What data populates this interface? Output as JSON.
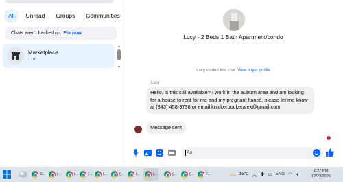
{
  "left_panel": {
    "filters": [
      "All",
      "Unread",
      "Groups",
      "Communities"
    ],
    "active_filter": "All",
    "backup_notice": "Chats aren't backed up.",
    "backup_fix": "Fix now",
    "conversations": [
      {
        "name": "Marketplace",
        "time": "· 1m",
        "icon": "storefront-icon"
      }
    ]
  },
  "chat": {
    "title": "Lucy - 2 Beds 1 Bath Apartment/condo",
    "started_text": "Lucy started this chat.",
    "view_profile": "View buyer profile",
    "sender": "Lucy",
    "messages": [
      "Hello, is this still available? I work in the auburn area and am looking for a house to rent for me and my pregnant fiancé, please let me know at (843) 458-3736 or email knickerbockeralex@gmail.com",
      "Message sent"
    ],
    "composer_placeholder": "Aa",
    "composer_icons": [
      "microphone-icon",
      "photo-icon",
      "sticker-icon",
      "gif-icon"
    ],
    "accent_color": "#0866ff"
  },
  "taskbar": {
    "items": [
      {
        "label": "S...",
        "icon": "chrome-icon"
      },
      {
        "label": "(...",
        "icon": "chrome-icon"
      },
      {
        "label": "(...",
        "icon": "chrome-icon"
      },
      {
        "label": "(...",
        "icon": "chrome-icon"
      },
      {
        "label": "(...",
        "icon": "chrome-icon"
      },
      {
        "label": "(...",
        "icon": "chrome-icon"
      },
      {
        "label": "(...",
        "icon": "chrome-icon"
      },
      {
        "label": "(...",
        "icon": "chrome-icon"
      },
      {
        "label": "(...",
        "icon": "chrome-icon"
      },
      {
        "label": "(...",
        "icon": "chrome-icon"
      },
      {
        "label": "F...",
        "icon": "chrome-icon"
      }
    ],
    "weather": "15°C",
    "language": "ENG",
    "time": "8:27 PM",
    "date": "12/23/2025"
  }
}
